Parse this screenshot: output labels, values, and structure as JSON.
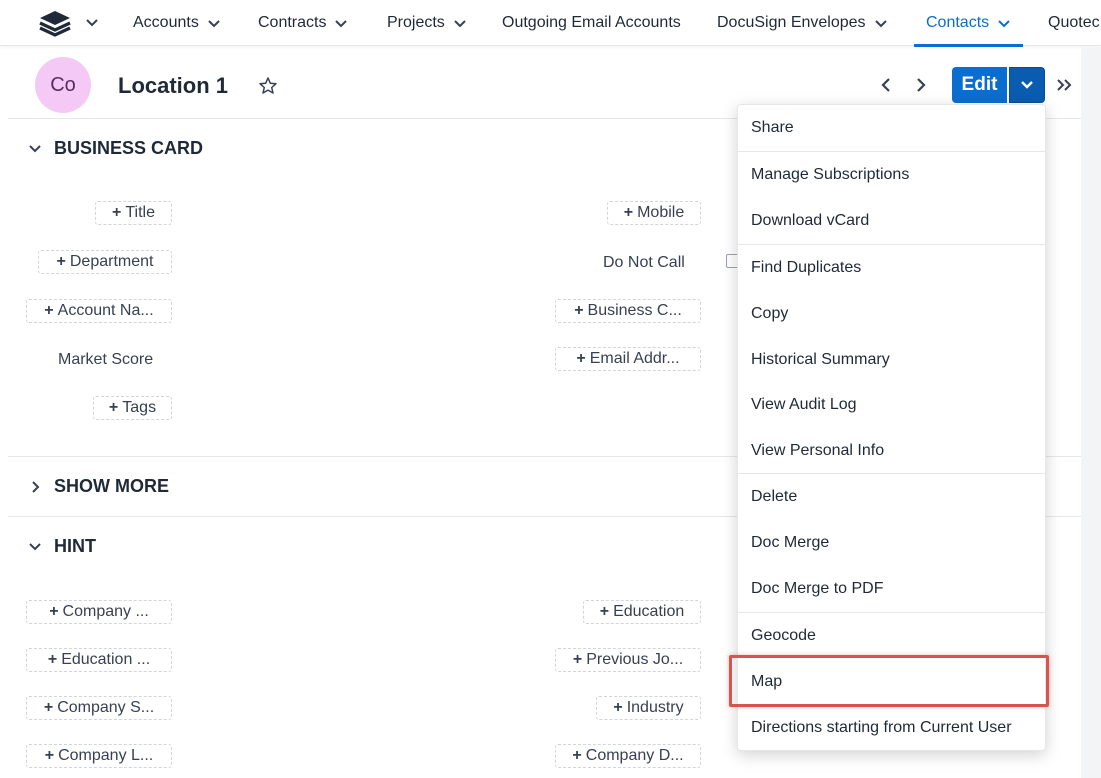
{
  "nav": {
    "items": [
      {
        "label": "Accounts"
      },
      {
        "label": "Contracts"
      },
      {
        "label": "Projects"
      },
      {
        "label": "Outgoing Email Accounts"
      },
      {
        "label": "DocuSign Envelopes"
      },
      {
        "label": "Contacts"
      },
      {
        "label": "Quotec"
      }
    ],
    "active": "Contacts",
    "accent_color": "#0a6ed1"
  },
  "record": {
    "avatar_initials": "Co",
    "title": "Location 1",
    "edit_label": "Edit"
  },
  "sections": {
    "business_card": {
      "title": "BUSINESS CARD",
      "fields": {
        "title": "Title",
        "department": "Department",
        "account_name": "Account Na...",
        "market_score": "Market Score",
        "tags": "Tags",
        "mobile": "Mobile",
        "do_not_call": "Do Not Call",
        "business_c": "Business C...",
        "email_addr": "Email Addr..."
      }
    },
    "show_more": {
      "title": "SHOW MORE"
    },
    "hint": {
      "title": "HINT",
      "fields": {
        "company_1": "Company ...",
        "education_1": "Education ...",
        "company_s": "Company S...",
        "company_l": "Company L...",
        "education": "Education",
        "previous_jo": "Previous Jo...",
        "industry": "Industry",
        "company_d": "Company D..."
      }
    }
  },
  "menu": {
    "items": [
      "Share",
      "Manage Subscriptions",
      "Download vCard",
      "Find Duplicates",
      "Copy",
      "Historical Summary",
      "View Audit Log",
      "View Personal Info",
      "Delete",
      "Doc Merge",
      "Doc Merge to PDF",
      "Geocode",
      "Map",
      "Directions starting from Current User"
    ],
    "highlighted": "Map",
    "highlight_color": "#d9534f"
  }
}
